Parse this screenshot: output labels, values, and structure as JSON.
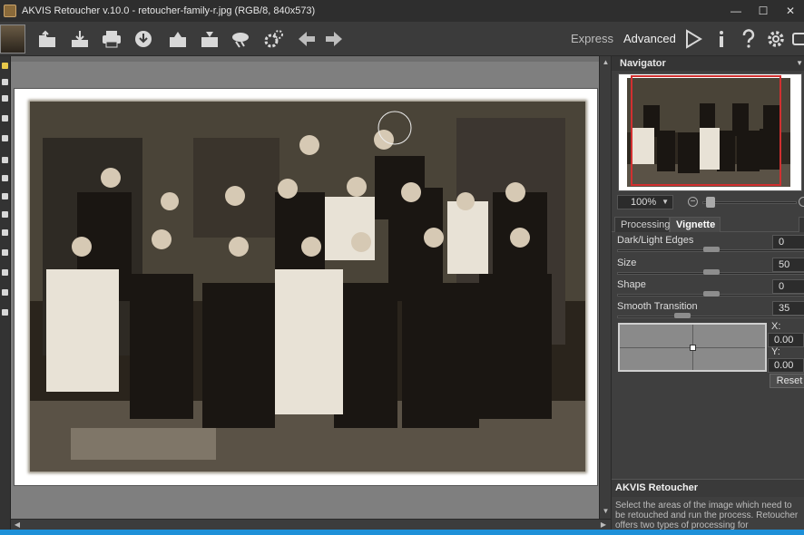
{
  "window": {
    "title": "AKVIS Retoucher v.10.0 - retoucher-family-r.jpg (RGB/8, 840x573)",
    "controls": [
      "minimize",
      "maximize",
      "close"
    ]
  },
  "toolbar": {
    "icons": [
      "photo-thumbnail-icon",
      "open-file-icon",
      "save-file-icon",
      "print-icon",
      "share-icon",
      "import-preset-icon",
      "export-preset-icon",
      "batch-icon",
      "preferences-gear-icon",
      "undo-arrow-icon",
      "redo-arrow-icon"
    ],
    "mode_express": "Express",
    "mode_advanced": "Advanced",
    "right_icons": [
      "run-play-icon",
      "info-icon",
      "help-icon",
      "settings-gear-icon",
      "feedback-icon"
    ]
  },
  "tools": [
    "retouch-brush-tool",
    "clone-tool",
    "eraser-tool",
    "patch-tool",
    "selection-tool",
    "chameleon-tool",
    "stamp-tool",
    "blur-tool",
    "sharpen-tool",
    "smudge-tool",
    "healing-tool",
    "crop-tool",
    "hand-tool",
    "zoom-tool"
  ],
  "navigator": {
    "title": "Navigator",
    "zoom": "100%"
  },
  "panel": {
    "tabs": [
      "Processing",
      "Vignette"
    ],
    "active_tab": "Vignette",
    "params": [
      {
        "label": "Dark/Light Edges",
        "value": "0",
        "pos": 0.5
      },
      {
        "label": "Size",
        "value": "50",
        "pos": 0.5
      },
      {
        "label": "Shape",
        "value": "0",
        "pos": 0.5
      },
      {
        "label": "Smooth Transition",
        "value": "35",
        "pos": 0.35
      }
    ],
    "x_label": "X:",
    "x_value": "0.00",
    "y_label": "Y:",
    "y_value": "0.00",
    "reset_label": "Reset"
  },
  "help": {
    "title": "AKVIS Retoucher",
    "text": "Select the areas of the image which need to be retouched and run the process. Retoucher offers two types of processing for"
  },
  "colors": {
    "accent": "#1e90d8",
    "panel_bg": "#3f3f3f",
    "navigator_frame": "#d23030"
  }
}
